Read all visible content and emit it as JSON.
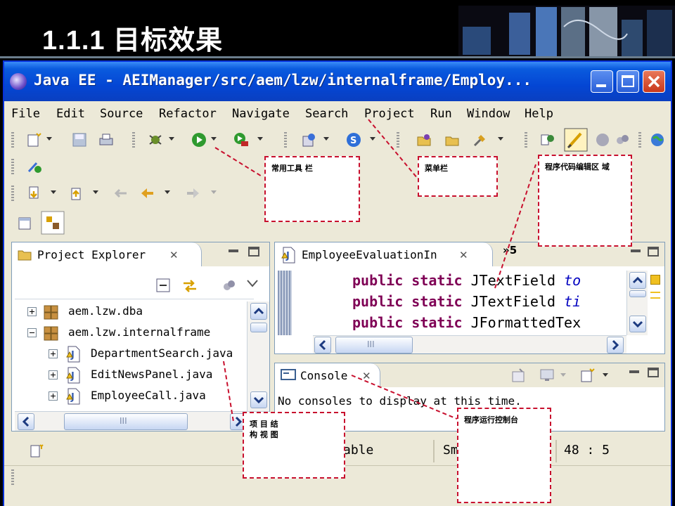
{
  "slide": {
    "title": "1.1.1 目标效果"
  },
  "window": {
    "title": "Java EE - AEIManager/src/aem/lzw/internalframe/Employ..."
  },
  "menu": [
    "File",
    "Edit",
    "Source",
    "Refactor",
    "Navigate",
    "Search",
    "Project",
    "Run",
    "Window",
    "Help"
  ],
  "project_explorer": {
    "tab_label": "Project Explorer",
    "items": [
      {
        "label": "aem.lzw.dba",
        "level": 0,
        "expanded": false
      },
      {
        "label": "aem.lzw.internalframe",
        "level": 0,
        "expanded": true
      },
      {
        "label": "DepartmentSearch.java",
        "level": 1,
        "expanded": false
      },
      {
        "label": "EditNewsPanel.java",
        "level": 1,
        "expanded": false
      },
      {
        "label": "EmployeeCall.java",
        "level": 1,
        "expanded": false
      }
    ]
  },
  "editor": {
    "tab_label": "EmployeeEvaluationIn",
    "overflow_count": "»5",
    "lines": [
      {
        "kw": "public static",
        "type": "JTextField",
        "field": "to"
      },
      {
        "kw": "public static",
        "type": "JTextField",
        "field": "ti"
      },
      {
        "kw": "public static",
        "type": "JFormattedTex",
        "field": ""
      }
    ]
  },
  "console": {
    "tab_label": "Console",
    "message": "No consoles to display at this time."
  },
  "status": {
    "writable": "able",
    "insert_mode": "Sm",
    "position": "48 : 5"
  },
  "annotations": {
    "toolbar": "常用工具 栏",
    "menubar": "菜单栏",
    "editor": "程序代码编辑区 域",
    "project_view_line1": "项 目 结",
    "project_view_line2": "构 视 图",
    "console": "程序运行控制台"
  },
  "colors": {
    "titlebar": "#0a5bde",
    "keyword": "#7f0055",
    "field": "#0000c0",
    "callout_border": "#c8102e"
  },
  "scrollbar_label": "III"
}
